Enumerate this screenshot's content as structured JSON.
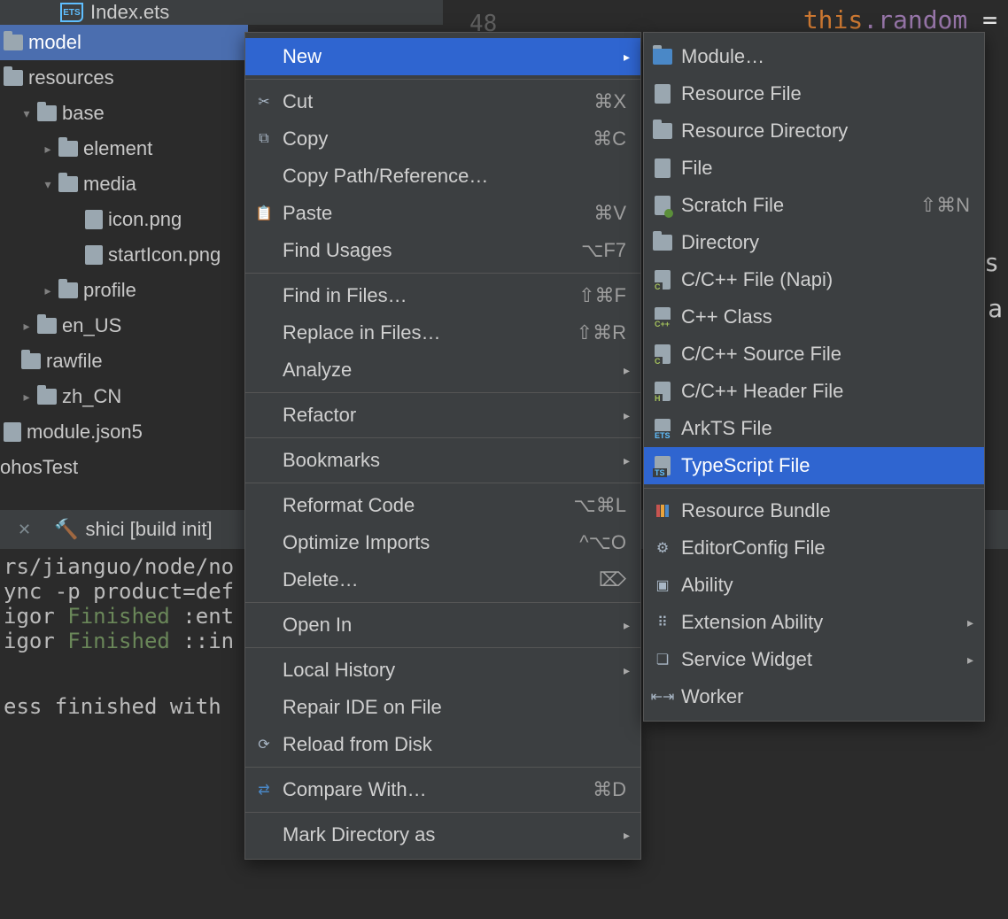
{
  "tab": {
    "filename": "Index.ets"
  },
  "tree": {
    "model": "model",
    "resources": "resources",
    "base": "base",
    "element": "element",
    "media": "media",
    "icon_png": "icon.png",
    "starticon_png": "startIcon.png",
    "profile": "profile",
    "en_us": "en_US",
    "rawfile": "rawfile",
    "zh_cn": "zh_CN",
    "module_json5": "module.json5",
    "ohostest": "ohosTest"
  },
  "editor": {
    "line_no": "48",
    "kw_this": "this",
    "random": ".random",
    "eq": " = ",
    "dot_s": ". s",
    "trail": "a"
  },
  "terminal_tab": {
    "label": "shici [build init]"
  },
  "terminal": {
    "l1": "rs/jianguo/node/no",
    "l2": "ync -p product=def",
    "l3a": "igor ",
    "l3b": "Finished",
    "l3c": " :ent",
    "l4a": "igor ",
    "l4b": "Finished",
    "l4c": " ::in",
    "l5": "ess finished with"
  },
  "context_menu": [
    {
      "label": "New",
      "submenu": true,
      "highlight": true
    },
    "---",
    {
      "icon": "cut",
      "label": "Cut",
      "shortcut": "⌘X"
    },
    {
      "icon": "copy",
      "label": "Copy",
      "shortcut": "⌘C"
    },
    {
      "label": "Copy Path/Reference…"
    },
    {
      "icon": "paste",
      "label": "Paste",
      "shortcut": "⌘V"
    },
    {
      "label": "Find Usages",
      "shortcut": "⌥F7"
    },
    "---",
    {
      "label": "Find in Files…",
      "shortcut": "⇧⌘F"
    },
    {
      "label": "Replace in Files…",
      "shortcut": "⇧⌘R"
    },
    {
      "label": "Analyze",
      "submenu": true
    },
    "---",
    {
      "label": "Refactor",
      "submenu": true
    },
    "---",
    {
      "label": "Bookmarks",
      "submenu": true
    },
    "---",
    {
      "label": "Reformat Code",
      "shortcut": "⌥⌘L"
    },
    {
      "label": "Optimize Imports",
      "shortcut": "^⌥O"
    },
    {
      "label": "Delete…",
      "shortcut": "⌦"
    },
    "---",
    {
      "label": "Open In",
      "submenu": true
    },
    "---",
    {
      "label": "Local History",
      "submenu": true
    },
    {
      "label": "Repair IDE on File"
    },
    {
      "icon": "reload",
      "label": "Reload from Disk"
    },
    "---",
    {
      "icon": "diff",
      "label": "Compare With…",
      "shortcut": "⌘D"
    },
    "---",
    {
      "label": "Mark Directory as",
      "submenu": true
    }
  ],
  "new_submenu": [
    {
      "icon": "module",
      "label": "Module…"
    },
    {
      "icon": "file",
      "label": "Resource File"
    },
    {
      "icon": "folder",
      "label": "Resource Directory"
    },
    {
      "icon": "file",
      "label": "File"
    },
    {
      "icon": "scratch",
      "label": "Scratch File",
      "shortcut": "⇧⌘N"
    },
    {
      "icon": "folder",
      "label": "Directory"
    },
    {
      "icon": "c",
      "label": "C/C++ File (Napi)"
    },
    {
      "icon": "cpp",
      "label": "C++ Class"
    },
    {
      "icon": "c",
      "label": "C/C++ Source File"
    },
    {
      "icon": "h",
      "label": "C/C++ Header File"
    },
    {
      "icon": "ets",
      "label": "ArkTS File"
    },
    {
      "icon": "ts",
      "label": "TypeScript File",
      "highlight": true
    },
    "---",
    {
      "icon": "bundle",
      "label": "Resource Bundle"
    },
    {
      "icon": "gear",
      "label": "EditorConfig File"
    },
    {
      "icon": "ability",
      "label": "Ability"
    },
    {
      "icon": "grid",
      "label": "Extension Ability",
      "submenu": true
    },
    {
      "icon": "widget",
      "label": "Service Widget",
      "submenu": true
    },
    {
      "icon": "worker",
      "label": "Worker"
    }
  ]
}
